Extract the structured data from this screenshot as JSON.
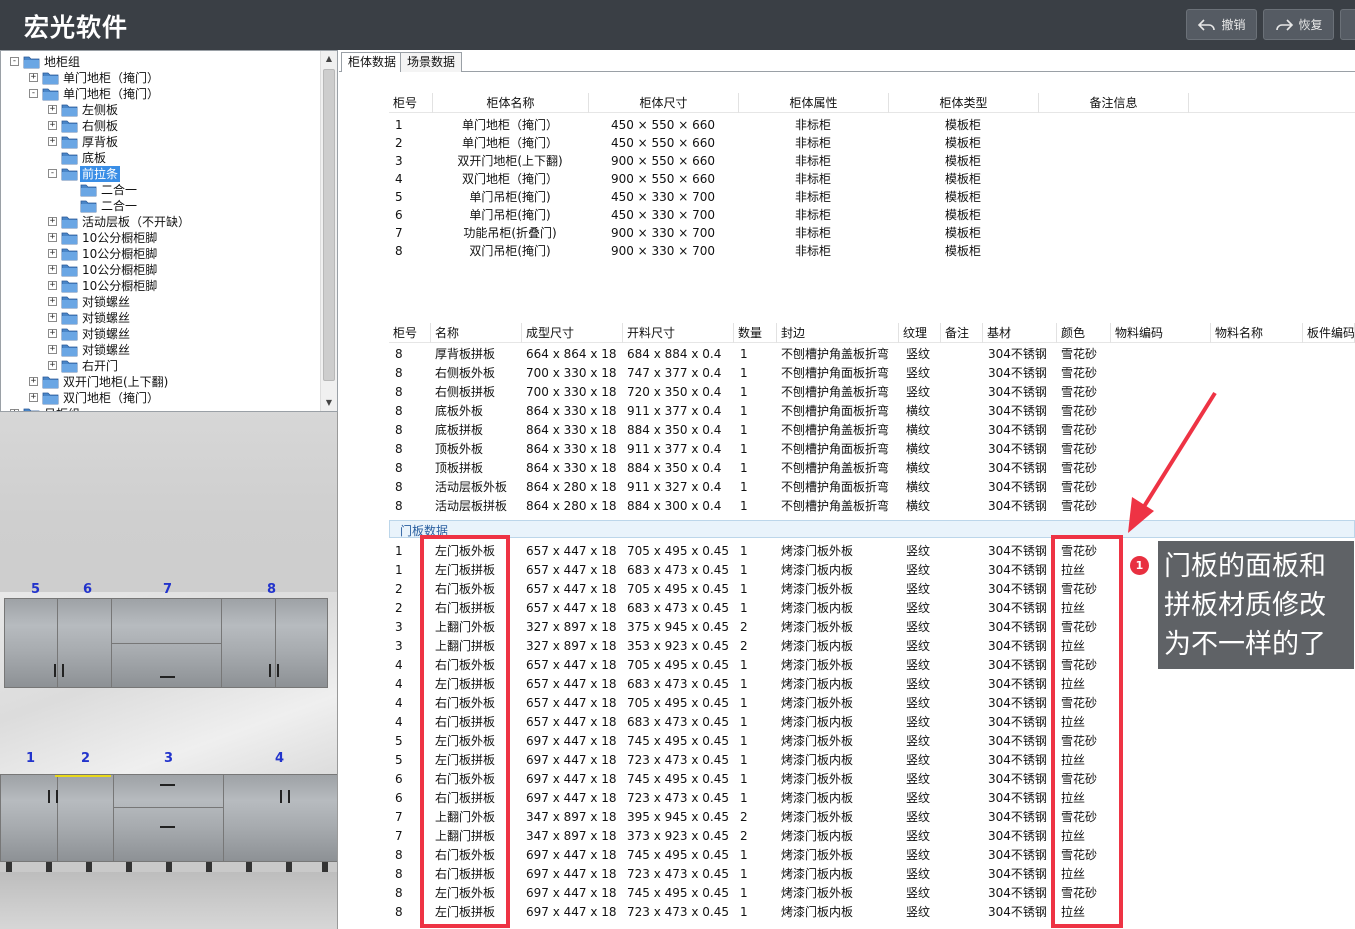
{
  "app": {
    "title": "宏光软件",
    "undo_label": "撤销",
    "redo_label": "恢复"
  },
  "tree": {
    "items": [
      {
        "label": "地柜组",
        "level": 0,
        "expander": "-"
      },
      {
        "label": "单门地柜（掩门）",
        "level": 1,
        "expander": "+"
      },
      {
        "label": "单门地柜（掩门）",
        "level": 1,
        "expander": "-"
      },
      {
        "label": "左侧板",
        "level": 2,
        "expander": "+"
      },
      {
        "label": "右侧板",
        "level": 2,
        "expander": "+"
      },
      {
        "label": "厚背板",
        "level": 2,
        "expander": "+"
      },
      {
        "label": "底板",
        "level": 2,
        "expander": ""
      },
      {
        "label": "前拉条",
        "level": 2,
        "expander": "-",
        "selected": true
      },
      {
        "label": "二合一",
        "level": 3,
        "expander": ""
      },
      {
        "label": "二合一",
        "level": 3,
        "expander": ""
      },
      {
        "label": "活动层板（不开缺）",
        "level": 2,
        "expander": "+"
      },
      {
        "label": "10公分橱柜脚",
        "level": 2,
        "expander": "+"
      },
      {
        "label": "10公分橱柜脚",
        "level": 2,
        "expander": "+"
      },
      {
        "label": "10公分橱柜脚",
        "level": 2,
        "expander": "+"
      },
      {
        "label": "10公分橱柜脚",
        "level": 2,
        "expander": "+"
      },
      {
        "label": "对锁螺丝",
        "level": 2,
        "expander": "+"
      },
      {
        "label": "对锁螺丝",
        "level": 2,
        "expander": "+"
      },
      {
        "label": "对锁螺丝",
        "level": 2,
        "expander": "+"
      },
      {
        "label": "对锁螺丝",
        "level": 2,
        "expander": "+"
      },
      {
        "label": "右开门",
        "level": 2,
        "expander": "+"
      },
      {
        "label": "双开门地柜(上下翻)",
        "level": 1,
        "expander": "+"
      },
      {
        "label": "双门地柜（掩门）",
        "level": 1,
        "expander": "+"
      },
      {
        "label": "吊柜组",
        "level": 0,
        "expander": "+"
      }
    ]
  },
  "viewport": {
    "top_numbers": [
      "5",
      "6",
      "7",
      "8"
    ],
    "bottom_numbers": [
      "1",
      "2",
      "3",
      "4"
    ]
  },
  "tabs": [
    "柜体数据",
    "场景数据"
  ],
  "cabinet_table": {
    "headers": [
      "柜号",
      "柜体名称",
      "柜体尺寸",
      "柜体属性",
      "柜体类型",
      "备注信息"
    ],
    "rows": [
      [
        "1",
        "单门地柜（掩门）",
        "450 × 550 × 660",
        "非标柜",
        "模板柜",
        ""
      ],
      [
        "2",
        "单门地柜（掩门）",
        "450 × 550 × 660",
        "非标柜",
        "模板柜",
        ""
      ],
      [
        "3",
        "双开门地柜(上下翻)",
        "900 × 550 × 660",
        "非标柜",
        "模板柜",
        ""
      ],
      [
        "4",
        "双门地柜（掩门）",
        "900 × 550 × 660",
        "非标柜",
        "模板柜",
        ""
      ],
      [
        "5",
        "单门吊柜(掩门)",
        "450 × 330 × 700",
        "非标柜",
        "模板柜",
        ""
      ],
      [
        "6",
        "单门吊柜(掩门)",
        "450 × 330 × 700",
        "非标柜",
        "模板柜",
        ""
      ],
      [
        "7",
        "功能吊柜(折叠门)",
        "900 × 330 × 700",
        "非标柜",
        "模板柜",
        ""
      ],
      [
        "8",
        "双门吊柜(掩门)",
        "900 × 330 × 700",
        "非标柜",
        "模板柜",
        ""
      ]
    ]
  },
  "board_table": {
    "headers": [
      "柜号",
      "名称",
      "成型尺寸",
      "开料尺寸",
      "数量",
      "封边",
      "纹理",
      "备注",
      "基材",
      "颜色",
      "物料编码",
      "物料名称",
      "板件编码"
    ],
    "rows": [
      [
        "8",
        "厚背板拼板",
        "664 x 864 x 18",
        "684 x 884 x 0.4",
        "1",
        "不刨槽护角盖板折弯",
        "竖纹",
        "",
        "304不锈钢",
        "雪花砂"
      ],
      [
        "8",
        "右侧板外板",
        "700 x 330 x 18",
        "747 x 377 x 0.4",
        "1",
        "不刨槽护角面板折弯",
        "竖纹",
        "",
        "304不锈钢",
        "雪花砂"
      ],
      [
        "8",
        "右侧板拼板",
        "700 x 330 x 18",
        "720 x 350 x 0.4",
        "1",
        "不刨槽护角盖板折弯",
        "竖纹",
        "",
        "304不锈钢",
        "雪花砂"
      ],
      [
        "8",
        "底板外板",
        "864 x 330 x 18",
        "911 x 377 x 0.4",
        "1",
        "不刨槽护角面板折弯",
        "横纹",
        "",
        "304不锈钢",
        "雪花砂"
      ],
      [
        "8",
        "底板拼板",
        "864 x 330 x 18",
        "884 x 350 x 0.4",
        "1",
        "不刨槽护角盖板折弯",
        "横纹",
        "",
        "304不锈钢",
        "雪花砂"
      ],
      [
        "8",
        "顶板外板",
        "864 x 330 x 18",
        "911 x 377 x 0.4",
        "1",
        "不刨槽护角面板折弯",
        "横纹",
        "",
        "304不锈钢",
        "雪花砂"
      ],
      [
        "8",
        "顶板拼板",
        "864 x 330 x 18",
        "884 x 350 x 0.4",
        "1",
        "不刨槽护角盖板折弯",
        "横纹",
        "",
        "304不锈钢",
        "雪花砂"
      ],
      [
        "8",
        "活动层板外板",
        "864 x 280 x 18",
        "911 x 327 x 0.4",
        "1",
        "不刨槽护角面板折弯",
        "横纹",
        "",
        "304不锈钢",
        "雪花砂"
      ],
      [
        "8",
        "活动层板拼板",
        "864 x 280 x 18",
        "884 x 300 x 0.4",
        "1",
        "不刨槽护角盖板折弯",
        "横纹",
        "",
        "304不锈钢",
        "雪花砂"
      ]
    ]
  },
  "door_section": {
    "title": "门板数据",
    "rows": [
      [
        "1",
        "左门板外板",
        "657 x 447 x 18",
        "705 x 495 x 0.45",
        "1",
        "烤漆门板外板",
        "竖纹",
        "",
        "304不锈钢",
        "雪花砂"
      ],
      [
        "1",
        "左门板拼板",
        "657 x 447 x 18",
        "683 x 473 x 0.45",
        "1",
        "烤漆门板内板",
        "竖纹",
        "",
        "304不锈钢",
        "拉丝"
      ],
      [
        "2",
        "右门板外板",
        "657 x 447 x 18",
        "705 x 495 x 0.45",
        "1",
        "烤漆门板外板",
        "竖纹",
        "",
        "304不锈钢",
        "雪花砂"
      ],
      [
        "2",
        "右门板拼板",
        "657 x 447 x 18",
        "683 x 473 x 0.45",
        "1",
        "烤漆门板内板",
        "竖纹",
        "",
        "304不锈钢",
        "拉丝"
      ],
      [
        "3",
        "上翻门外板",
        "327 x 897 x 18",
        "375 x 945 x 0.45",
        "2",
        "烤漆门板外板",
        "竖纹",
        "",
        "304不锈钢",
        "雪花砂"
      ],
      [
        "3",
        "上翻门拼板",
        "327 x 897 x 18",
        "353 x 923 x 0.45",
        "2",
        "烤漆门板内板",
        "竖纹",
        "",
        "304不锈钢",
        "拉丝"
      ],
      [
        "4",
        "右门板外板",
        "657 x 447 x 18",
        "705 x 495 x 0.45",
        "1",
        "烤漆门板外板",
        "竖纹",
        "",
        "304不锈钢",
        "雪花砂"
      ],
      [
        "4",
        "左门板拼板",
        "657 x 447 x 18",
        "683 x 473 x 0.45",
        "1",
        "烤漆门板内板",
        "竖纹",
        "",
        "304不锈钢",
        "拉丝"
      ],
      [
        "4",
        "右门板外板",
        "657 x 447 x 18",
        "705 x 495 x 0.45",
        "1",
        "烤漆门板外板",
        "竖纹",
        "",
        "304不锈钢",
        "雪花砂"
      ],
      [
        "4",
        "右门板拼板",
        "657 x 447 x 18",
        "683 x 473 x 0.45",
        "1",
        "烤漆门板内板",
        "竖纹",
        "",
        "304不锈钢",
        "拉丝"
      ],
      [
        "5",
        "左门板外板",
        "697 x 447 x 18",
        "745 x 495 x 0.45",
        "1",
        "烤漆门板外板",
        "竖纹",
        "",
        "304不锈钢",
        "雪花砂"
      ],
      [
        "5",
        "左门板拼板",
        "697 x 447 x 18",
        "723 x 473 x 0.45",
        "1",
        "烤漆门板内板",
        "竖纹",
        "",
        "304不锈钢",
        "拉丝"
      ],
      [
        "6",
        "右门板外板",
        "697 x 447 x 18",
        "745 x 495 x 0.45",
        "1",
        "烤漆门板外板",
        "竖纹",
        "",
        "304不锈钢",
        "雪花砂"
      ],
      [
        "6",
        "右门板拼板",
        "697 x 447 x 18",
        "723 x 473 x 0.45",
        "1",
        "烤漆门板内板",
        "竖纹",
        "",
        "304不锈钢",
        "拉丝"
      ],
      [
        "7",
        "上翻门外板",
        "347 x 897 x 18",
        "395 x 945 x 0.45",
        "2",
        "烤漆门板外板",
        "竖纹",
        "",
        "304不锈钢",
        "雪花砂"
      ],
      [
        "7",
        "上翻门拼板",
        "347 x 897 x 18",
        "373 x 923 x 0.45",
        "2",
        "烤漆门板内板",
        "竖纹",
        "",
        "304不锈钢",
        "拉丝"
      ],
      [
        "8",
        "右门板外板",
        "697 x 447 x 18",
        "745 x 495 x 0.45",
        "1",
        "烤漆门板外板",
        "竖纹",
        "",
        "304不锈钢",
        "雪花砂"
      ],
      [
        "8",
        "右门板拼板",
        "697 x 447 x 18",
        "723 x 473 x 0.45",
        "1",
        "烤漆门板内板",
        "竖纹",
        "",
        "304不锈钢",
        "拉丝"
      ],
      [
        "8",
        "左门板外板",
        "697 x 447 x 18",
        "745 x 495 x 0.45",
        "1",
        "烤漆门板外板",
        "竖纹",
        "",
        "304不锈钢",
        "雪花砂"
      ],
      [
        "8",
        "左门板拼板",
        "697 x 447 x 18",
        "723 x 473 x 0.45",
        "1",
        "烤漆门板内板",
        "竖纹",
        "",
        "304不锈钢",
        "拉丝"
      ]
    ]
  },
  "annotation": {
    "badge": "1",
    "text_lines": [
      "门板的面板和",
      "拼板材质修改",
      "为不一样的了"
    ],
    "highlight_color": "#ee3344"
  }
}
